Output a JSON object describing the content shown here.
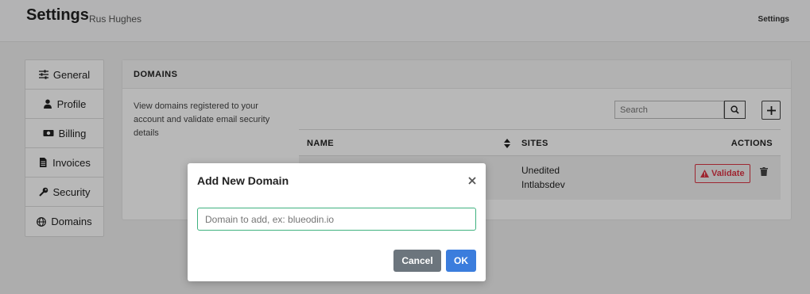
{
  "header": {
    "title": "Settings",
    "user": "Rus Hughes",
    "link": "Settings"
  },
  "sidebar": {
    "items": [
      {
        "label": "General",
        "icon": "sliders-icon"
      },
      {
        "label": "Profile",
        "icon": "user-icon"
      },
      {
        "label": "Billing",
        "icon": "money-icon"
      },
      {
        "label": "Invoices",
        "icon": "file-icon"
      },
      {
        "label": "Security",
        "icon": "key-icon"
      },
      {
        "label": "Domains",
        "icon": "globe-icon"
      }
    ]
  },
  "panel": {
    "title": "DOMAINS",
    "description": "View domains registered to your account and validate email security details",
    "search_placeholder": "Search",
    "table": {
      "headers": {
        "name": "NAME",
        "sites": "SITES",
        "actions": "ACTIONS"
      },
      "rows": [
        {
          "name": "",
          "sites": [
            "Unedited",
            "Intlabsdev"
          ],
          "validate_label": "Validate"
        }
      ]
    }
  },
  "modal": {
    "title": "Add New Domain",
    "input_placeholder": "Domain to add, ex: blueodin.io",
    "cancel_label": "Cancel",
    "ok_label": "OK"
  },
  "colors": {
    "primary": "#3b7ddd",
    "danger": "#dc3545",
    "secondary": "#6c757d",
    "input_focus": "#3fb27f"
  }
}
